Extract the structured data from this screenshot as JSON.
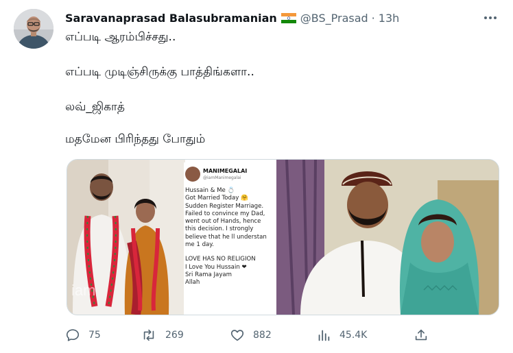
{
  "author": {
    "name": "Saravanaprasad Balasubramanian",
    "handle": "@BS_Prasad",
    "separator": "·",
    "time": "13h"
  },
  "tweet_lines": [
    "எப்படி ஆரம்பிச்சது..",
    "எப்படி முடிஞ்சிருக்கு பாத்திங்களா..",
    "லவ்_ஜிகாத்",
    "மதமேன பிரிந்தது போதும்"
  ],
  "media": {
    "embedded_post": {
      "name": "MANIMEGALAI",
      "handle": "@iamManimegalai",
      "lines": [
        "Hussain & Me 💍",
        "Got Married Today 🤗",
        "Sudden Register Marriage.",
        "Failed to convince my Dad,",
        "went out of Hands, hence",
        "this decision. I strongly",
        "believe that he ll understan",
        "me 1 day.",
        "",
        "LOVE HAS NO RELIGION",
        "I Love You Hussain ❤",
        "Sri Rama Jayam",
        "Allah"
      ]
    },
    "watermark": "iam"
  },
  "actions": {
    "replies": "75",
    "retweets": "269",
    "likes": "882",
    "views": "45.4K"
  },
  "colors": {
    "text": "#0f1419",
    "secondary": "#536471",
    "border": "#cfd9de"
  }
}
